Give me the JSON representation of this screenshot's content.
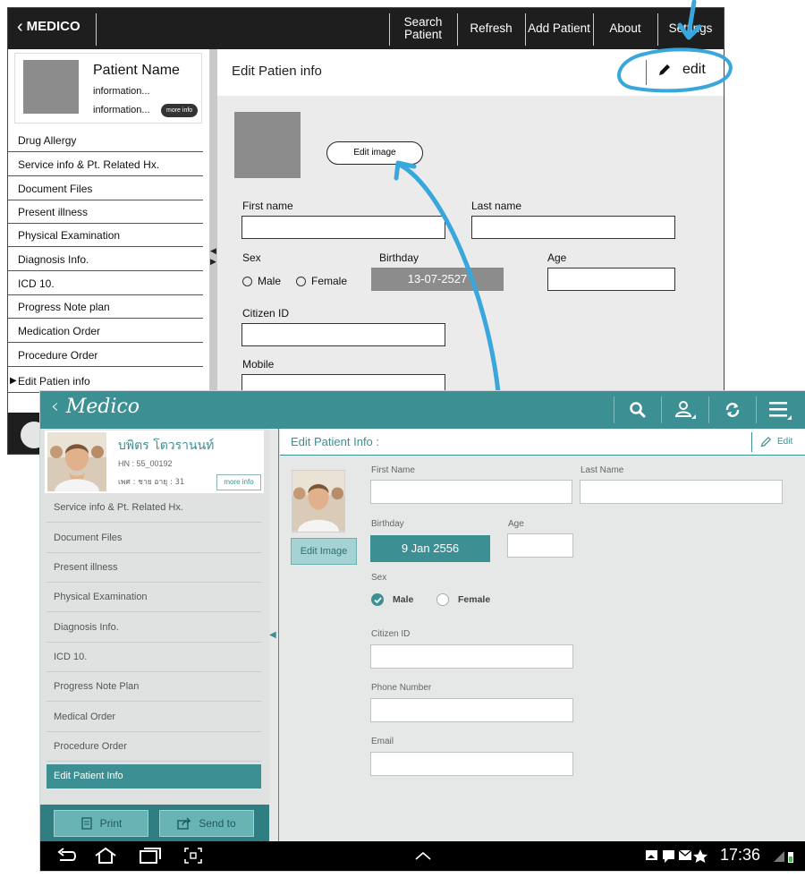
{
  "wireframe": {
    "back_label": "MEDICO",
    "nav": [
      "Search Patient",
      "Refresh",
      "Add Patient",
      "About",
      "Settings"
    ],
    "patient": {
      "name": "Patient Name",
      "info1": "information...",
      "info2": "information...",
      "more": "more info"
    },
    "sidebar_items": [
      "Drug Allergy",
      "Service info & Pt. Related Hx.",
      "Document Files",
      "Present illness",
      "Physical Examination",
      "Diagnosis Info.",
      "ICD 10.",
      "Progress Note plan",
      "Medication Order",
      "Procedure Order",
      "Edit Patien info"
    ],
    "header_title": "Edit Patien info",
    "edit_label": "edit",
    "edit_image_label": "Edit image",
    "form": {
      "first_name": "First name",
      "last_name": "Last name",
      "sex": "Sex",
      "male": "Male",
      "female": "Female",
      "birthday": "Birthday",
      "birthday_value": "13-07-2527",
      "age": "Age",
      "citizen_id": "Citizen ID",
      "mobile": "Mobile"
    }
  },
  "tablet": {
    "brand": "Medico",
    "patient": {
      "name": "บพิตร โตวรานนท์",
      "hn": "HN : 55_00192",
      "details": "เพศ : ชาย  อายุ : 31",
      "more": "more info"
    },
    "sidebar_items": [
      "Service info & Pt. Related Hx.",
      "Document Files",
      "Present illness",
      "Physical Examination",
      "Diagnosis Info.",
      "ICD 10.",
      "Progress Note Plan",
      "Medical Order",
      "Procedure Order",
      "Edit Patient Info"
    ],
    "print_label": "Print",
    "send_label": "Send to",
    "header_title": "Edit Patient Info :",
    "edit_label": "Edit",
    "edit_image_label": "Edit Image",
    "form": {
      "first_name": "First Name",
      "last_name": "Last Name",
      "birthday": "Birthday",
      "birthday_value": "9 Jan 2556",
      "age": "Age",
      "sex": "Sex",
      "male": "Male",
      "female": "Female",
      "sex_selected": "Male",
      "citizen_id": "Citizen ID",
      "phone": "Phone Number",
      "email": "Email"
    },
    "clock": "17:36"
  },
  "colors": {
    "teal": "#3c8f92",
    "annotation_blue": "#3aa7dc",
    "wire_bar": "#1e1e1e"
  },
  "icons": [
    "chevron-left-icon",
    "pencil-icon",
    "search-icon",
    "user-pin-icon",
    "refresh-icon",
    "menu-icon",
    "printer-icon",
    "share-icon",
    "back-icon",
    "home-icon",
    "recent-apps-icon",
    "screenshot-icon",
    "chevron-up-icon",
    "signal-icon",
    "battery-icon",
    "star-icon"
  ]
}
